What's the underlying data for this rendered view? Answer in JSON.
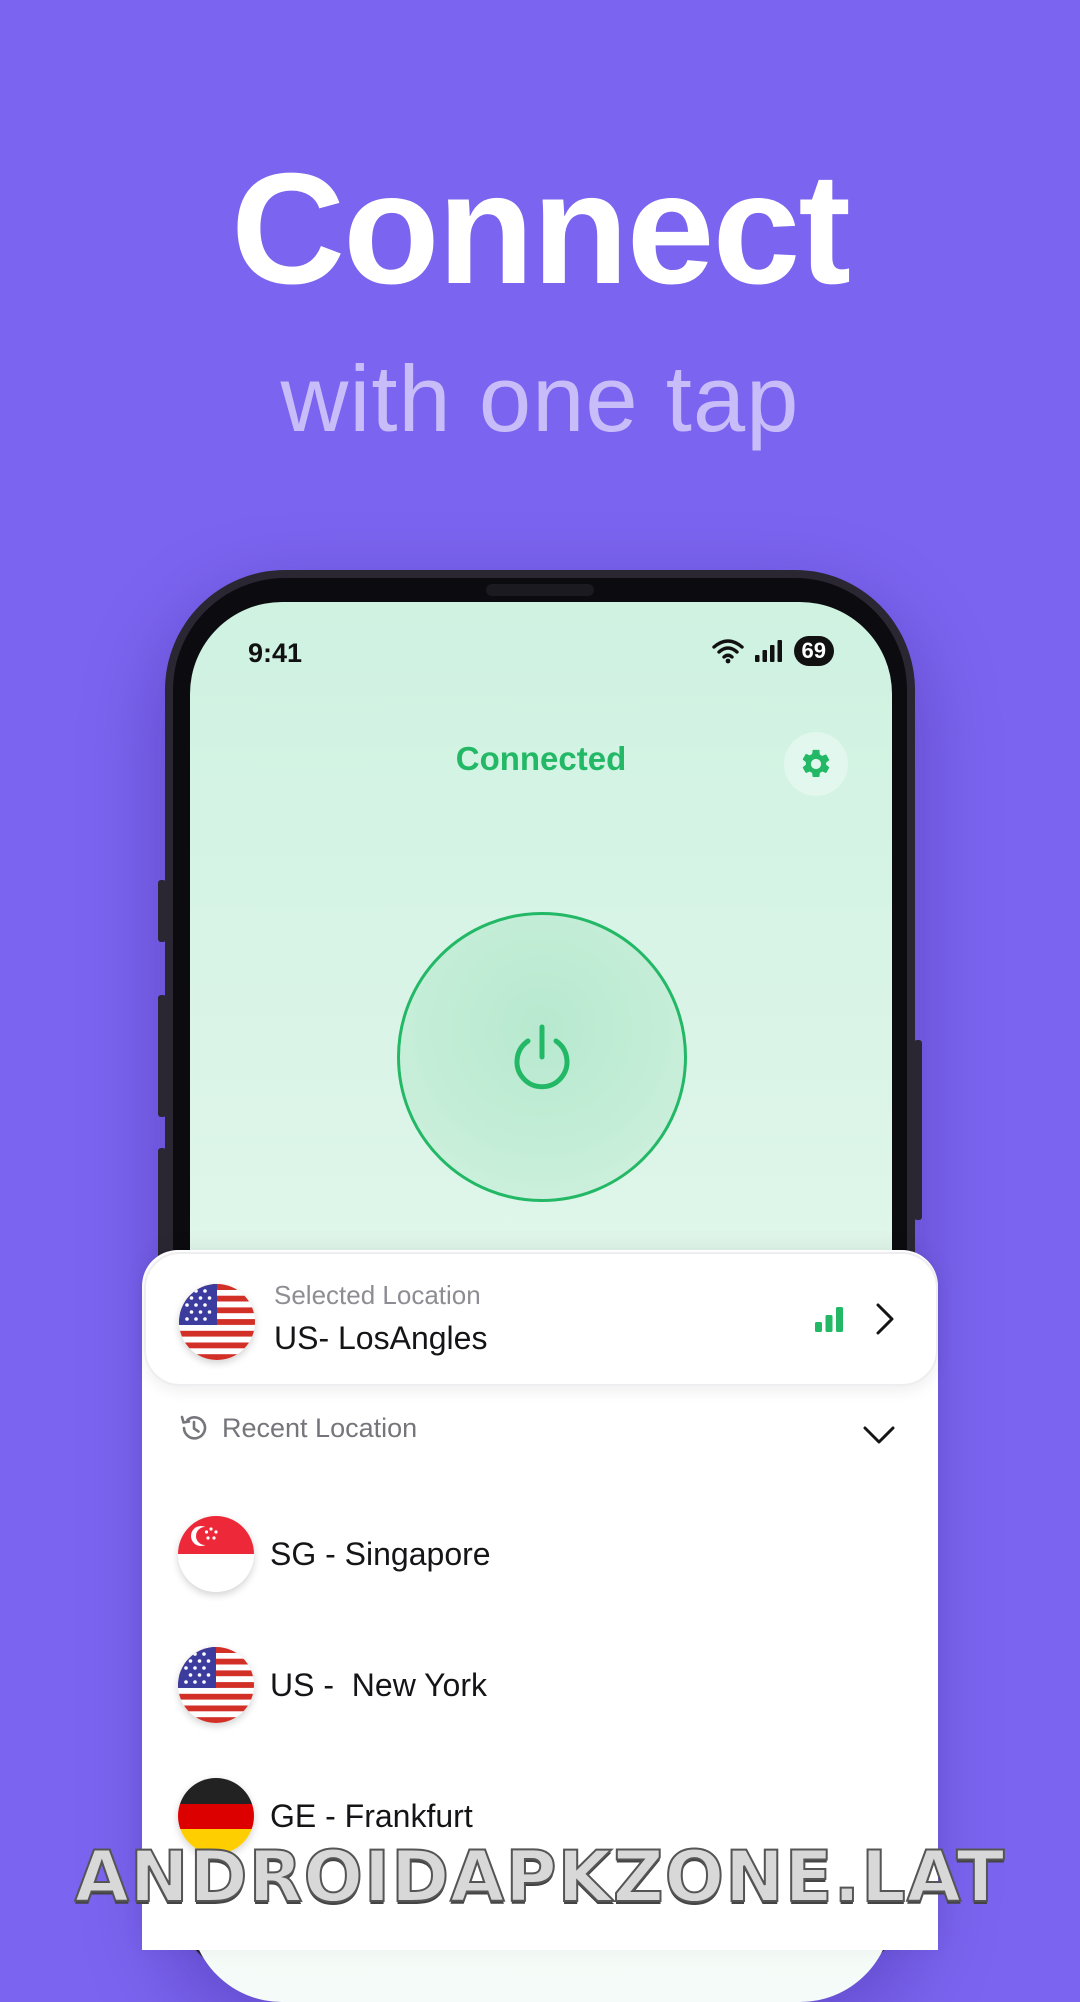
{
  "promo": {
    "headline": "Connect",
    "subheadline": "with one tap"
  },
  "status_bar": {
    "time": "9:41",
    "battery": "69"
  },
  "main": {
    "connection_status": "Connected",
    "settings_icon": "gear-icon",
    "power_icon": "power-icon"
  },
  "selected_location": {
    "label": "Selected Location",
    "value": "US- LosAngles",
    "flag": "us-flag"
  },
  "recent": {
    "label": "Recent Location",
    "items": [
      {
        "name": "SG - Singapore",
        "flag": "sg-flag"
      },
      {
        "name": "US -  New York",
        "flag": "us-flag"
      },
      {
        "name": "GE - Frankfurt",
        "flag": "de-flag"
      }
    ]
  },
  "watermark": "ANDROIDAPKZONE.LAT",
  "colors": {
    "background": "#7B64EF",
    "accent_green": "#22B866",
    "subheadline": "#C9BDF9"
  }
}
